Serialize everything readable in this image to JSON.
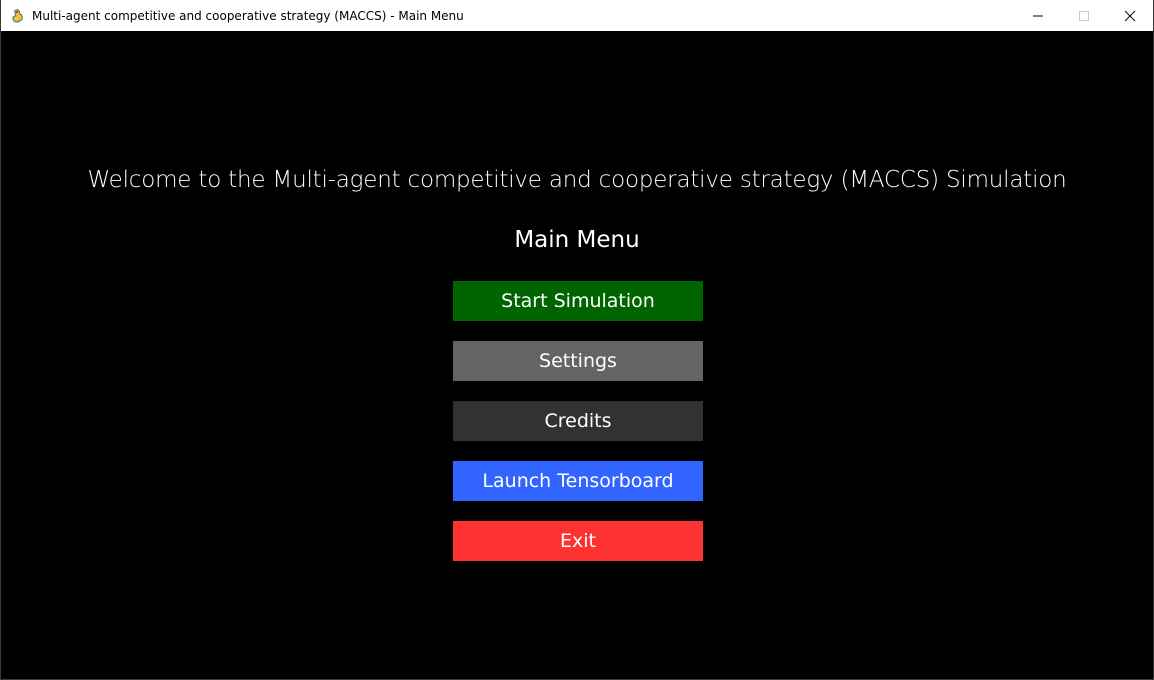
{
  "window": {
    "title": "Multi-agent competitive and cooperative strategy (MACCS) - Main Menu",
    "icon": "pygame-snake-icon"
  },
  "main": {
    "welcome_text": "Welcome to the Multi-agent competitive and cooperative strategy (MACCS) Simulation",
    "menu_title": "Main Menu"
  },
  "buttons": {
    "start": {
      "label": "Start Simulation",
      "color": "#006400"
    },
    "settings": {
      "label": "Settings",
      "color": "#646464"
    },
    "credits": {
      "label": "Credits",
      "color": "#323232"
    },
    "tensorboard": {
      "label": "Launch Tensorboard",
      "color": "#3264ff"
    },
    "exit": {
      "label": "Exit",
      "color": "#ff3232"
    }
  }
}
